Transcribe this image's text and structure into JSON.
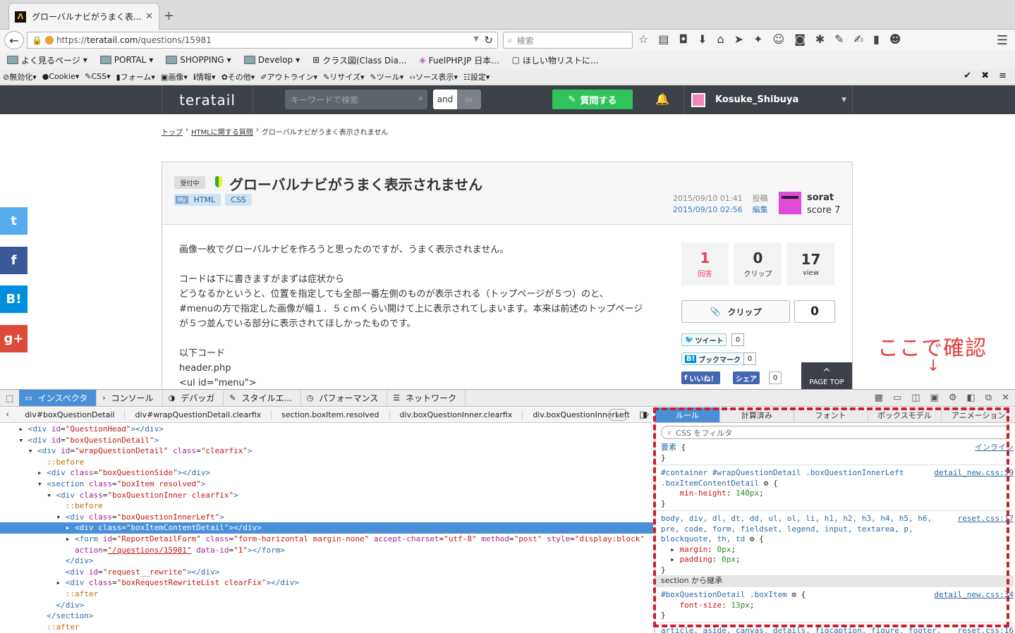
{
  "browser": {
    "tab_title": "グローバルナビがうまく表...",
    "url_prefix": "https://",
    "url_host": "teratail.com",
    "url_path": "/questions/15981",
    "search_placeholder": "検索",
    "bookmarks": [
      "よく見るページ",
      "PORTAL",
      "SHOPPING",
      "Develop",
      "クラス図(Class Dia...",
      "FuelPHP.JP 日本...",
      "ほしい物リストに..."
    ],
    "webdev": [
      "無効化",
      "Cookie",
      "CSS",
      "フォーム",
      "画像",
      "情報",
      "その他",
      "アウトライン",
      "リサイズ",
      "ツール",
      "ソース表示",
      "設定"
    ]
  },
  "site": {
    "logo": "teratail",
    "keyword_placeholder": "キーワードで検索",
    "and_label": "and",
    "or_label": "or",
    "ask_label": "質問する",
    "username": "Kosuke_Shibuya"
  },
  "breadcrumb": {
    "home": "トップ",
    "category": "HTMLに関する質問",
    "current": "グローバルナビがうまく表示されません"
  },
  "social": [
    "t",
    "f",
    "B!",
    "g+"
  ],
  "question": {
    "status": "受付中",
    "title": "グローバルナビがうまく表示されません",
    "my_badge": "My",
    "tags": [
      "HTML",
      "CSS"
    ],
    "posted_date": "2015/09/10 01:41",
    "posted_label": "投稿",
    "edited_date": "2015/09/10 02:56",
    "edited_label": "編集",
    "author": "sorat",
    "score": "score 7",
    "body": [
      "画像一枚でグローバルナビを作ろうと思ったのですが、うまく表示されません。",
      "",
      "コードは下に書きますがまずは症状から",
      "どうなるかというと、位置を指定しても全部一番左側のものが表示される（トップページが５つ）のと、",
      "#menuの方で指定した画像が幅１．５ｃｍくらい開けて上に表示されてしまいます。本来は前述のトップページ",
      "が５つ並んでいる部分に表示されてほしかったものです。",
      "",
      "以下コード",
      "header.php",
      "<ul id=\"menu\">"
    ],
    "stats": [
      {
        "num": "1",
        "label": "回答"
      },
      {
        "num": "0",
        "label": "クリップ"
      },
      {
        "num": "17",
        "label": "view"
      }
    ],
    "clip_label": "クリップ",
    "clip_count": "0",
    "tweet_label": "ツイート",
    "tweet_count": "0",
    "bookmark_label": "ブックマーク",
    "bookmark_count": "0",
    "like_label": "いいね！",
    "share_label": "シェア",
    "like_count": "0",
    "page_top": "PAGE TOP"
  },
  "annotation": "ここで確認",
  "devtools": {
    "tabs": [
      "インスペクタ",
      "コンソール",
      "デバッガ",
      "スタイルエ...",
      "パフォーマンス",
      "ネットワーク"
    ],
    "crumbs": [
      "div#boxQuestionDetail",
      "div#wrapQuestionDetail.clearfix",
      "section.boxItem.resolved",
      "div.boxQuestionInner.clearfix",
      "div.boxQuestionInnerLeft"
    ],
    "rule_tabs": [
      "ルール",
      "計算済み",
      "フォント",
      "ボックスモデル",
      "アニメーション"
    ],
    "filter_placeholder": "CSS をフィルタ",
    "inherited_label": "section から継承"
  }
}
